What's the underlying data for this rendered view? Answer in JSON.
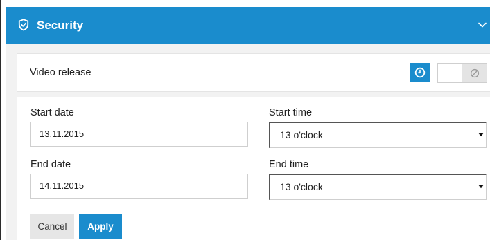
{
  "header": {
    "title": "Security",
    "icon": "shield-icon",
    "toggle_icon": "chevron-down-icon",
    "color": "#1a8ccd"
  },
  "release": {
    "label": "Video release",
    "schedule_icon": "clock-icon",
    "toggle_icon": "disabled-icon"
  },
  "form": {
    "start_date": {
      "label": "Start date",
      "value": "13.11.2015"
    },
    "end_date": {
      "label": "End date",
      "value": "14.11.2015"
    },
    "start_time": {
      "label": "Start time",
      "selected": "13 o'clock"
    },
    "end_time": {
      "label": "End time",
      "selected": "13 o'clock"
    }
  },
  "actions": {
    "cancel_label": "Cancel",
    "apply_label": "Apply"
  }
}
